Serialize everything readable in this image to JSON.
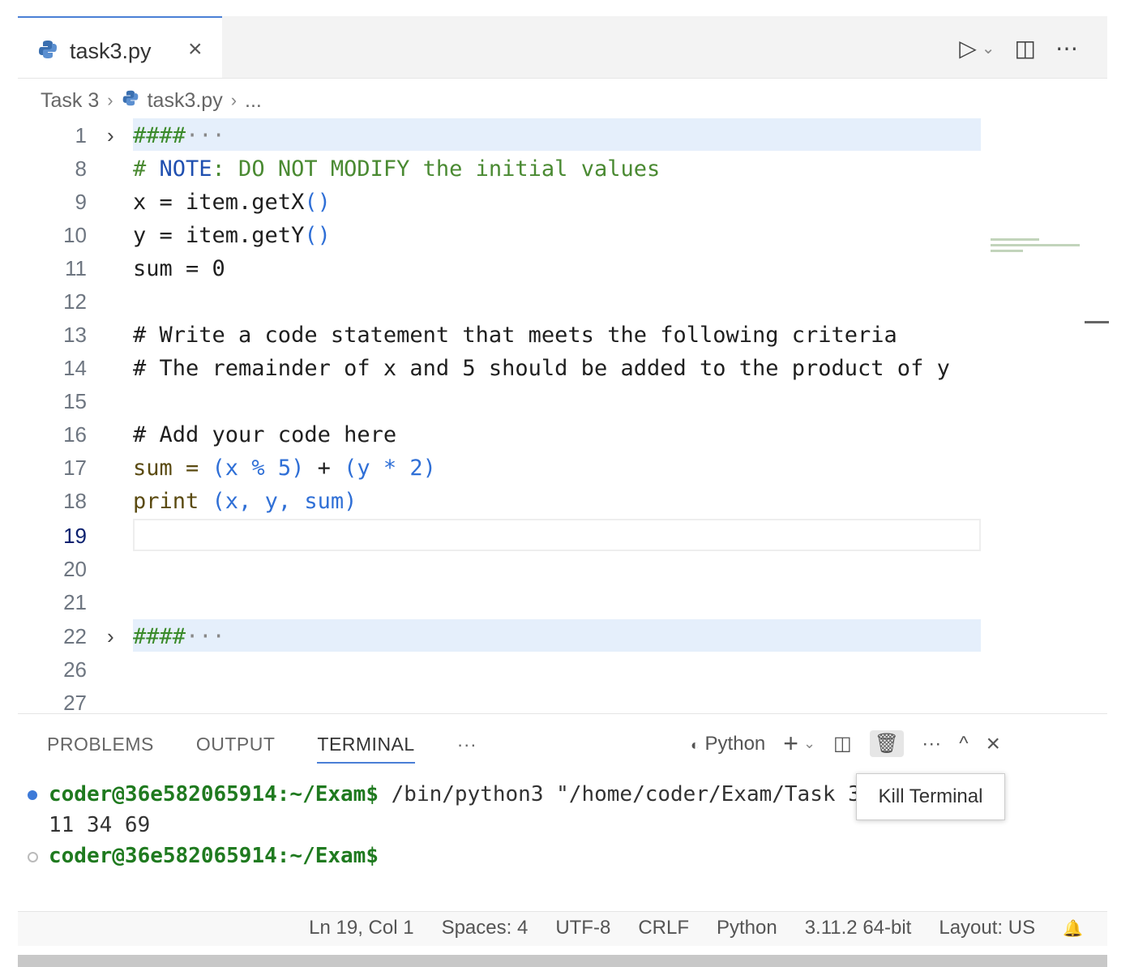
{
  "tab": {
    "label": "task3.py",
    "close": "×"
  },
  "editor_actions": {
    "run": "▷",
    "run_chevron": "⌄",
    "split": "◫",
    "more": "⋯"
  },
  "breadcrumb": {
    "folder": "Task 3",
    "file": "task3.py",
    "more": "...",
    "sep": "›"
  },
  "code_lines": [
    {
      "n": "1"
    },
    {
      "n": "8"
    },
    {
      "n": "9"
    },
    {
      "n": "10"
    },
    {
      "n": "11"
    },
    {
      "n": "12"
    },
    {
      "n": "13"
    },
    {
      "n": "14"
    },
    {
      "n": "15"
    },
    {
      "n": "16"
    },
    {
      "n": "17"
    },
    {
      "n": "18"
    },
    {
      "n": "19"
    },
    {
      "n": "20"
    },
    {
      "n": "21"
    },
    {
      "n": "22"
    },
    {
      "n": "26"
    },
    {
      "n": "27"
    }
  ],
  "code_text": {
    "l1": "####",
    "l1_dots": "···",
    "l8_hash": "# ",
    "l8_note": "NOTE",
    "l8_rest": ": DO NOT MODIFY the initial values",
    "l9_a": "x = item.getX",
    "l9_p": "()",
    "l10_a": "y = item.getY",
    "l10_p": "()",
    "l11": "sum = 0",
    "l13": "# Write a code statement that meets the following criteria",
    "l14": "# The remainder of x and 5 should be added to the product of y",
    "l16": "# Add your code here",
    "l17_a": "sum = ",
    "l17_b": "(x % 5)",
    "l17_c": " + ",
    "l17_d": "(y * 2)",
    "l18_a": "print ",
    "l18_b": "(x, y, sum)",
    "l22": "####",
    "l22_dots": "···",
    "fold": "›"
  },
  "panel": {
    "tabs": [
      "PROBLEMS",
      "OUTPUT",
      "TERMINAL",
      "···"
    ],
    "profile": "Python",
    "add": "+",
    "add_chevron": "⌄",
    "split": "◫",
    "kill": "🗑",
    "more": "···",
    "maximize": "^",
    "close": "×"
  },
  "terminal": {
    "line1_prompt": "coder@36e582065914:~/Exam$",
    "line1_cmd": " /bin/python3 \"/home/coder/Exam/Task 3",
    "line2": "11 34 69",
    "line3_prompt": "coder@36e582065914:~/Exam$"
  },
  "tooltip": "Kill Terminal",
  "status": {
    "position": "Ln 19, Col 1",
    "spaces": "Spaces: 4",
    "encoding": "UTF-8",
    "eol": "CRLF",
    "language": "Python",
    "interpreter": "3.11.2 64-bit",
    "layout": "Layout: US",
    "bell": "🔔"
  }
}
